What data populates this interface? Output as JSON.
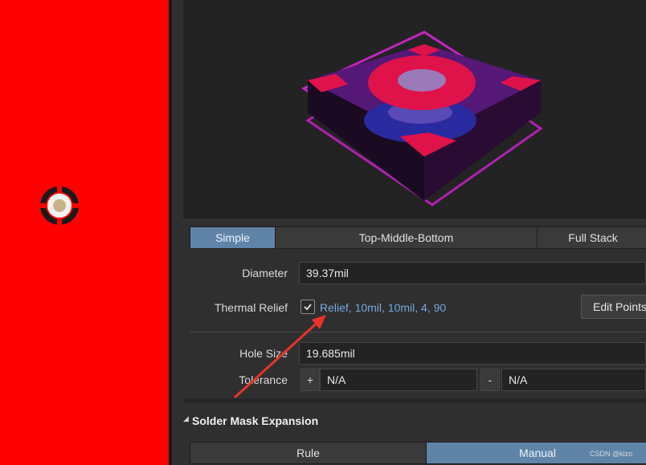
{
  "pad_stack_tabs": {
    "items": [
      "Simple",
      "Top-Middle-Bottom",
      "Full Stack"
    ],
    "active_index": 0
  },
  "properties": {
    "diameter_label": "Diameter",
    "diameter_value": "39.37mil",
    "thermal_relief_label": "Thermal Relief",
    "thermal_relief_checked": true,
    "thermal_relief_link": "Relief, 10mil, 10mil, 4, 90",
    "edit_points_label": "Edit Points",
    "hole_size_label": "Hole Size",
    "hole_size_value": "19.685mil",
    "tolerance_label": "Tolerance",
    "tolerance_plus_symbol": "+",
    "tolerance_plus_value": "N/A",
    "tolerance_minus_symbol": "-",
    "tolerance_minus_value": "N/A"
  },
  "solder_mask": {
    "section_title": "Solder Mask Expansion",
    "tabs": [
      "Rule",
      "Manual"
    ],
    "active_index": 1
  },
  "watermark": "CSDN @kizo",
  "colors": {
    "canvas_bg": "#ff0000",
    "accent_blue": "#5f84a8",
    "link_blue": "#74a9e0",
    "annotation_arrow": "#e8332a"
  }
}
